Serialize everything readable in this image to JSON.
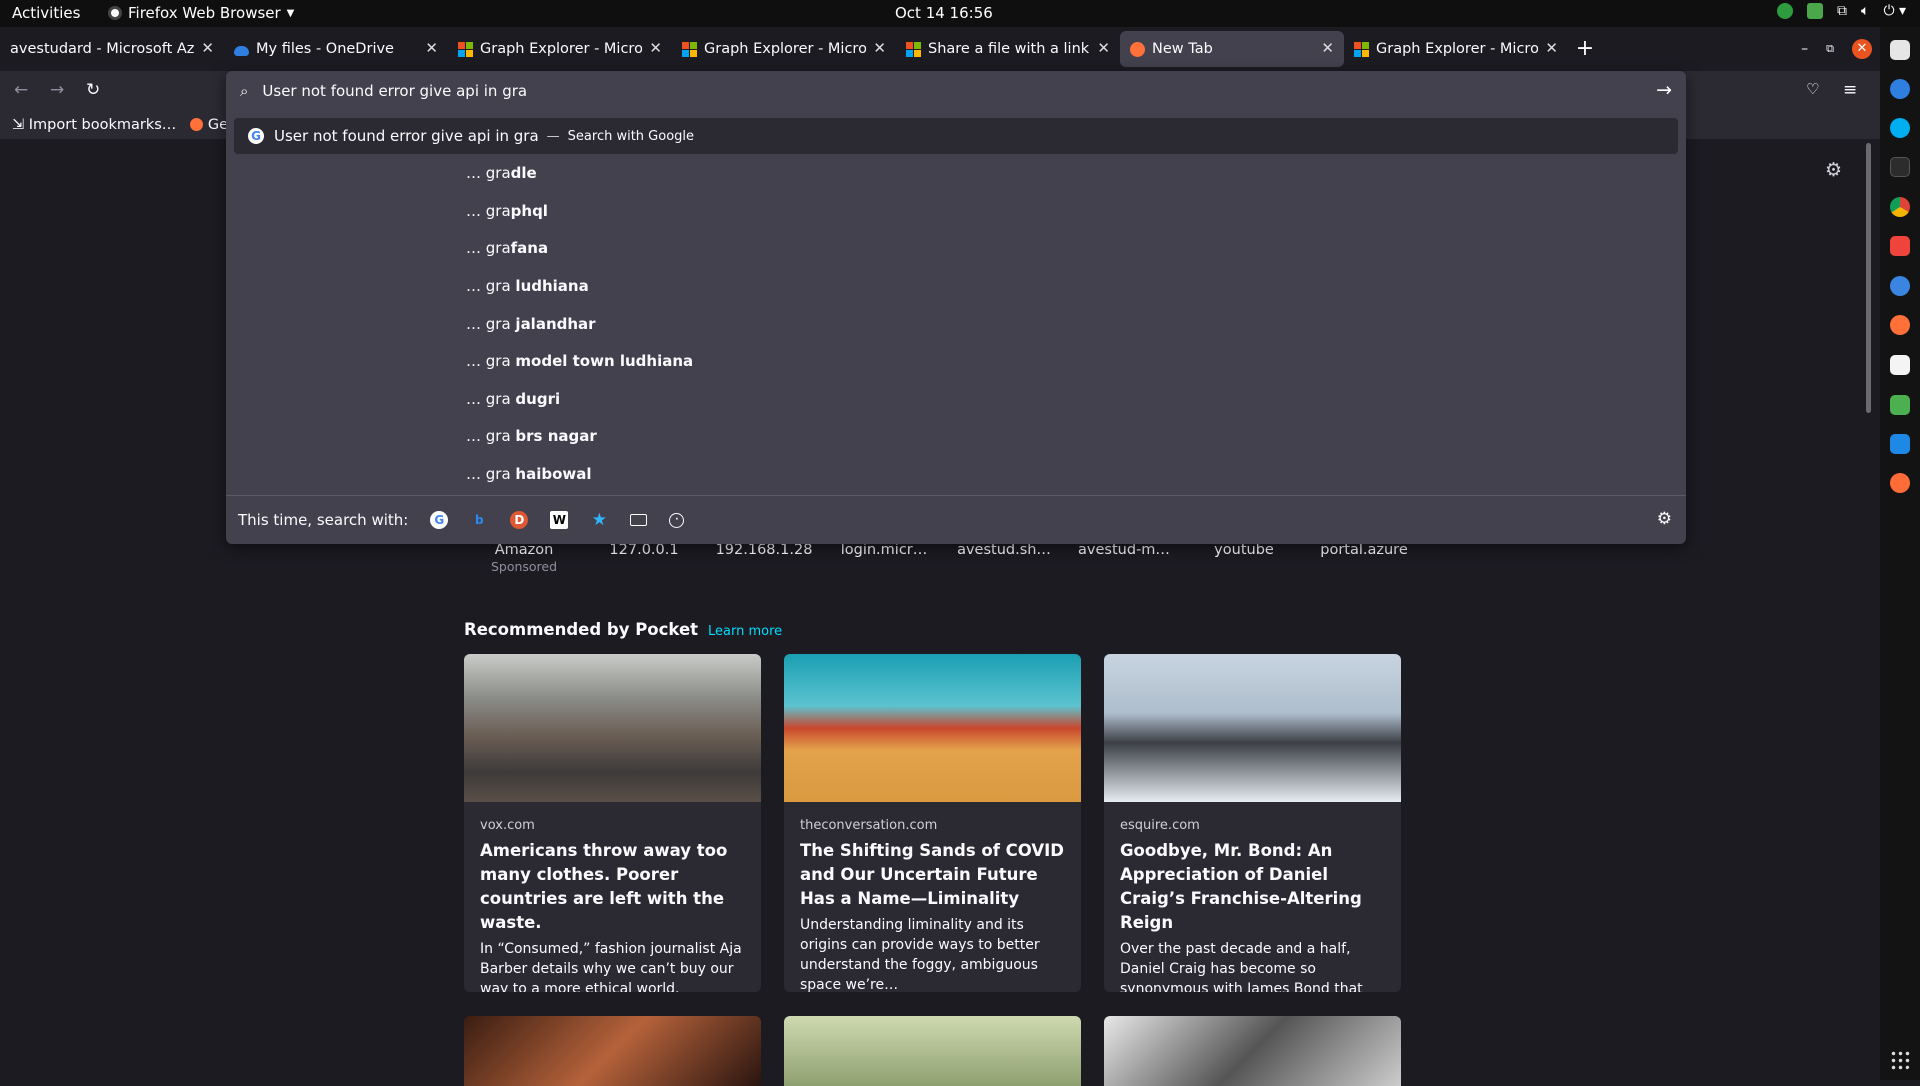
{
  "system": {
    "activities": "Activities",
    "app_name": "Firefox Web Browser",
    "datetime": "Oct 14  16:56"
  },
  "tabs": [
    {
      "label": "avestudard - Microsoft Azure",
      "active": false
    },
    {
      "label": "My files - OneDrive",
      "active": false
    },
    {
      "label": "Graph Explorer - Microsoft",
      "active": false
    },
    {
      "label": "Graph Explorer - Microsoft",
      "active": false
    },
    {
      "label": "Share a file with a link - M",
      "active": false
    },
    {
      "label": "New Tab",
      "active": true
    },
    {
      "label": "Graph Explorer - Microsoft",
      "active": false
    }
  ],
  "urlbar": {
    "value": "User not found error give api in gra"
  },
  "suggestions": {
    "main": {
      "text": "User not found error give api in gra",
      "separator": "—",
      "hint": "Search with Google"
    },
    "items": [
      {
        "prefix": "… gra",
        "bold": "dle"
      },
      {
        "prefix": "… gra",
        "bold": "phql"
      },
      {
        "prefix": "… gra",
        "bold": "fana"
      },
      {
        "prefix": "… gra ",
        "bold": "ludhiana"
      },
      {
        "prefix": "… gra ",
        "bold": "jalandhar"
      },
      {
        "prefix": "… gra ",
        "bold": "model town ludhiana"
      },
      {
        "prefix": "… gra ",
        "bold": "dugri"
      },
      {
        "prefix": "… gra ",
        "bold": "brs nagar"
      },
      {
        "prefix": "… gra ",
        "bold": "haibowal"
      }
    ],
    "oneoff_label": "This time, search with:"
  },
  "bookmarks": {
    "import": "Import bookmarks…",
    "getting": "Get"
  },
  "top_sites": [
    {
      "label": "Amazon",
      "sponsored": "Sponsored"
    },
    {
      "label": "127.0.0.1",
      "sponsored": ""
    },
    {
      "label": "192.168.1.28",
      "sponsored": ""
    },
    {
      "label": "login.micr…",
      "sponsored": ""
    },
    {
      "label": "avestud.sh…",
      "sponsored": ""
    },
    {
      "label": "avestud-m…",
      "sponsored": ""
    },
    {
      "label": "youtube",
      "sponsored": ""
    },
    {
      "label": "portal.azure",
      "sponsored": ""
    }
  ],
  "pocket": {
    "heading": "Recommended by Pocket",
    "learn_more": "Learn more",
    "cards": [
      {
        "source": "vox.com",
        "title": "Americans throw away too many clothes. Poorer countries are left with the waste.",
        "excerpt": "In “Consumed,” fashion journalist Aja Barber details why we can’t buy our way to a more ethical world."
      },
      {
        "source": "theconversation.com",
        "title": "The Shifting Sands of COVID and Our Uncertain Future Has a Name—Liminality",
        "excerpt": "Understanding liminality and its origins can provide ways to better understand the foggy, ambiguous space we’re…"
      },
      {
        "source": "esquire.com",
        "title": "Goodbye, Mr. Bond: An Appreciation of Daniel Craig’s Franchise-Altering Reign",
        "excerpt": "Over the past decade and a half, Daniel Craig has become so synonymous with James Bond that it’s easy to forget just…"
      }
    ]
  },
  "colors": {
    "accent": "#00ddff",
    "close": "#e95420",
    "panel": "#42414d",
    "toolbar": "#2b2a33",
    "page": "#1c1b22"
  }
}
